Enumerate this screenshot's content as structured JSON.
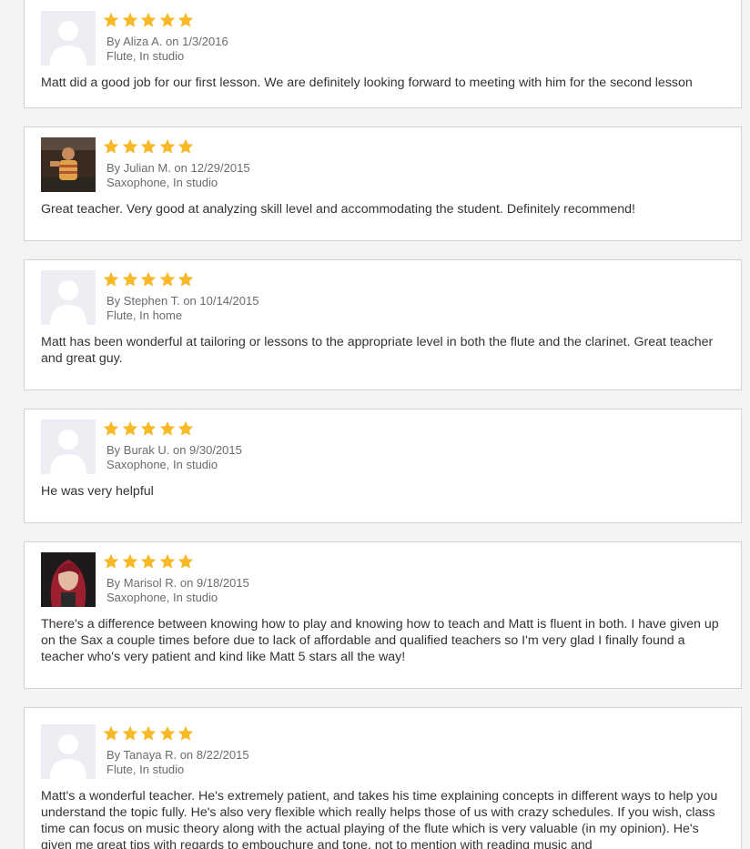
{
  "colors": {
    "star": "#f7b928",
    "card_border": "#d4d4d8",
    "page_background": "#f3f3f4"
  },
  "reviews": [
    {
      "rating": 5,
      "avatar": "default-avatar-icon",
      "byline": "By Aliza A. on 1/3/2016",
      "meta": "Flute, In studio",
      "text": "Matt did a good job for our first lesson. We are definitely looking forward to meeting with him for the second lesson"
    },
    {
      "rating": 5,
      "avatar": "user-photo",
      "byline": "By Julian M. on 12/29/2015",
      "meta": "Saxophone, In studio",
      "text": "Great teacher. Very good at analyzing skill level and accommodating the student. Definitely recommend!"
    },
    {
      "rating": 5,
      "avatar": "default-avatar-icon",
      "byline": "By Stephen T. on 10/14/2015",
      "meta": "Flute, In home",
      "text": "Matt has been wonderful at tailoring or lessons to the appropriate level in both the flute and the clarinet. Great teacher and great guy."
    },
    {
      "rating": 5,
      "avatar": "default-avatar-icon",
      "byline": "By Burak U. on 9/30/2015",
      "meta": "Saxophone, In studio",
      "text": "He was very helpful"
    },
    {
      "rating": 5,
      "avatar": "user-photo",
      "byline": "By Marisol R. on 9/18/2015",
      "meta": "Saxophone, In studio",
      "text": "There's a difference between knowing how to play and knowing how to teach and Matt is fluent in both. I have given up on the Sax a couple times before due to lack of affordable and qualified teachers so I'm very glad I finally found a teacher who's very patient and kind like Matt 5 stars all the way!"
    },
    {
      "rating": 5,
      "avatar": "default-avatar-icon",
      "byline": "By Tanaya R. on 8/22/2015",
      "meta": "Flute, In studio",
      "text": "Matt's a wonderful teacher. He's extremely patient, and takes his time explaining concepts in different ways to help you understand the topic fully. He's also very flexible which really helps those of us with crazy schedules. If you wish, class time can focus on music theory along with the actual playing of the flute which is very valuable (in my opinion). He's given me great tips with regards to embouchure and tone, not to mention with reading music and"
    }
  ]
}
